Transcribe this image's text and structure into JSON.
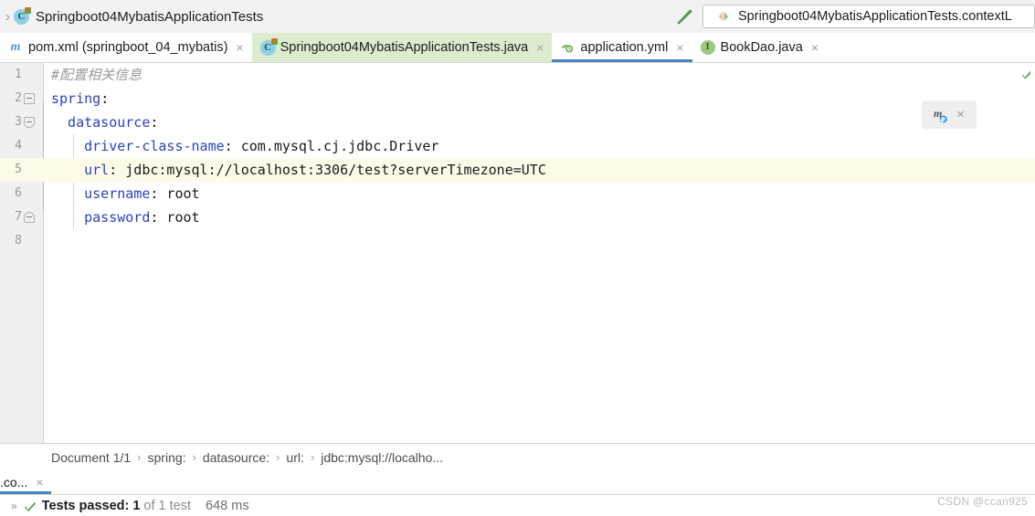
{
  "topbar": {
    "breadcrumb_chevron": "›",
    "class_icon": "java-class-icon",
    "title": "Springboot04MybatisApplicationTests",
    "wrench_icon": "wrench-icon",
    "run_config": {
      "icon": "run-config-icon",
      "label": "Springboot04MybatisApplicationTests.contextL"
    }
  },
  "tabs": [
    {
      "icon": "maven-xml-icon",
      "label": "pom.xml (springboot_04_mybatis)",
      "close": "×",
      "state": "normal"
    },
    {
      "icon": "java-class-icon",
      "label": "Springboot04MybatisApplicationTests.java",
      "close": "×",
      "state": "modified"
    },
    {
      "icon": "spring-yaml-icon",
      "label": "application.yml",
      "close": "×",
      "state": "active"
    },
    {
      "icon": "java-interface-icon",
      "label": "BookDao.java",
      "close": "×",
      "state": "normal"
    }
  ],
  "editor": {
    "language": "yaml",
    "current_line": 5,
    "lines": [
      {
        "num": "1",
        "indent": 0,
        "fold": "none",
        "segments": [
          {
            "text": "#配置相关信息",
            "type": "comment"
          }
        ]
      },
      {
        "num": "2",
        "indent": 0,
        "fold": "start",
        "segments": [
          {
            "text": "spring",
            "type": "key"
          },
          {
            "text": ":",
            "type": "plain"
          }
        ]
      },
      {
        "num": "3",
        "indent": 1,
        "fold": "mid",
        "segments": [
          {
            "text": "  datasource",
            "type": "key"
          },
          {
            "text": ":",
            "type": "plain"
          }
        ]
      },
      {
        "num": "4",
        "indent": 2,
        "fold": "none",
        "segments": [
          {
            "text": "    driver-class-name",
            "type": "key"
          },
          {
            "text": ": com.mysql.cj.jdbc.Driver",
            "type": "plain"
          }
        ]
      },
      {
        "num": "5",
        "indent": 2,
        "fold": "none",
        "segments": [
          {
            "text": "    url",
            "type": "key"
          },
          {
            "text": ": jdbc:mysql://localhost:3306/test?serverTimezone=UTC",
            "type": "plain"
          }
        ]
      },
      {
        "num": "6",
        "indent": 2,
        "fold": "none",
        "segments": [
          {
            "text": "    username",
            "type": "key"
          },
          {
            "text": ": root",
            "type": "plain"
          }
        ]
      },
      {
        "num": "7",
        "indent": 2,
        "fold": "end",
        "segments": [
          {
            "text": "    password",
            "type": "key"
          },
          {
            "text": ": root",
            "type": "plain"
          }
        ]
      },
      {
        "num": "8",
        "indent": 0,
        "fold": "none",
        "segments": []
      }
    ],
    "maven_popup": {
      "icon": "maven-reload-icon",
      "close": "×"
    },
    "inspection_marker": "inspection-ok-marker"
  },
  "breadcrumb": {
    "separator": "›",
    "items": [
      "Document 1/1",
      "spring:",
      "datasource:",
      "url:",
      "jdbc:mysql://localho..."
    ]
  },
  "bottom": {
    "tab_label": ".co...",
    "tab_close": "×",
    "expander": "»",
    "check_icon": "green-check-icon",
    "status_main": "Tests passed: 1",
    "status_dim": "of 1 test",
    "status_time": "648 ms"
  },
  "watermark": "CSDN @ccan925",
  "colors": {
    "accent_blue": "#4a84c4",
    "tab_modified_green": "#ddeccf",
    "current_line": "#fdfbe8",
    "yaml_key_blue": "#2b41c4",
    "comment_gray": "#9a9a9a",
    "gutter_bg": "#f0f0f0",
    "toolbar_bg": "#f2f2f2"
  }
}
